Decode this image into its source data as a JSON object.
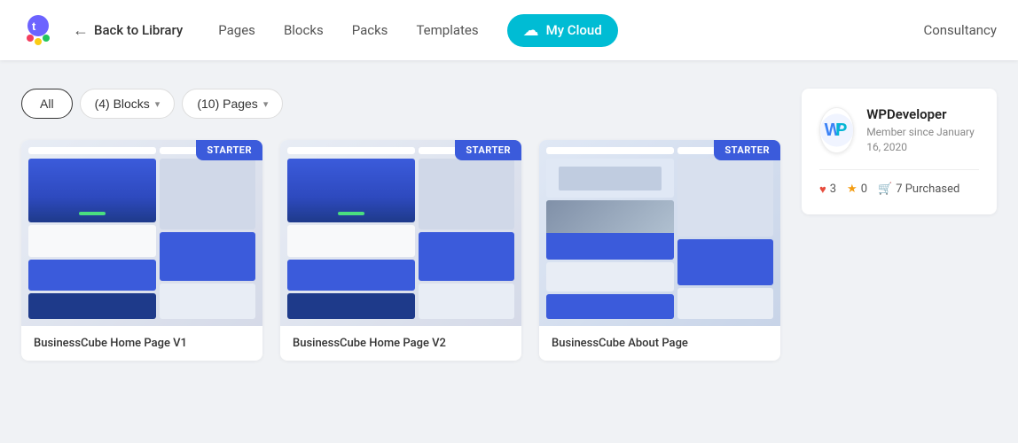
{
  "header": {
    "back_label": "Back to Library",
    "nav": [
      {
        "id": "pages",
        "label": "Pages"
      },
      {
        "id": "blocks",
        "label": "Blocks"
      },
      {
        "id": "packs",
        "label": "Packs"
      },
      {
        "id": "templates",
        "label": "Templates"
      }
    ],
    "my_cloud_label": "My Cloud",
    "consultancy_label": "Consultancy"
  },
  "filters": {
    "all_label": "All",
    "blocks_label": "(4)  Blocks",
    "pages_label": "(10)  Pages"
  },
  "cards": [
    {
      "id": "card-1",
      "title": "BusinessCube Home Page V1",
      "badge": "STARTER"
    },
    {
      "id": "card-2",
      "title": "BusinessCube Home Page V2",
      "badge": "STARTER"
    },
    {
      "id": "card-3",
      "title": "BusinessCube About Page",
      "badge": "STARTER"
    }
  ],
  "sidebar": {
    "developer_name": "WPDeveloper",
    "member_since": "Member since January 16, 2020",
    "hearts": "3",
    "stars": "0",
    "purchased": "7 Purchased"
  }
}
